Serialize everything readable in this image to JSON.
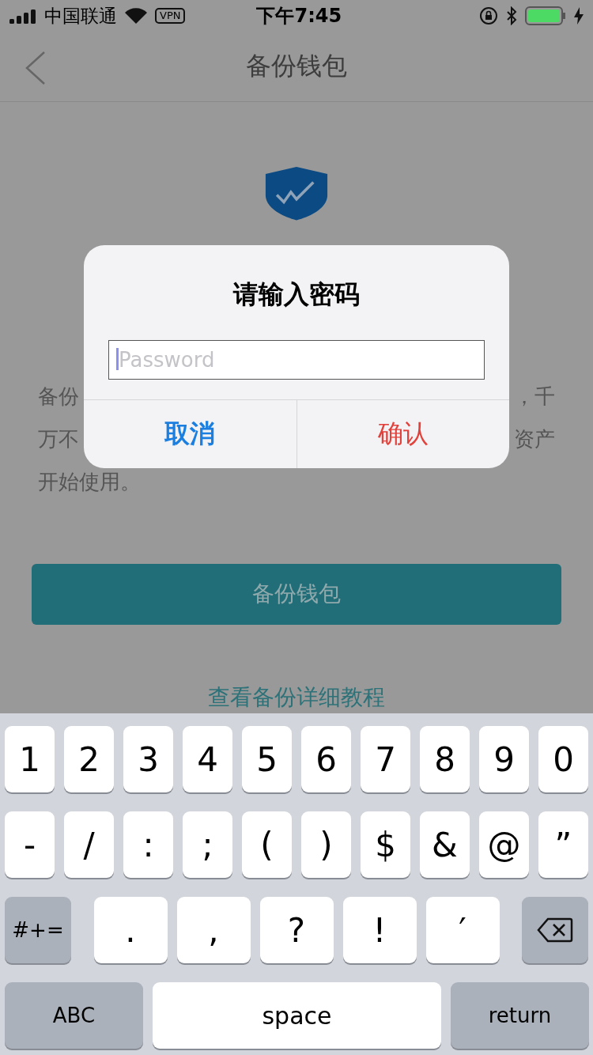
{
  "status_bar": {
    "carrier": "中国联通",
    "vpn": "VPN",
    "time": "下午7:45"
  },
  "nav": {
    "title": "备份钱包"
  },
  "page": {
    "paragraph_lines": [
      {
        "left": "备份",
        "right": "，千"
      },
      {
        "left": "万不",
        "right": "资产"
      },
      {
        "left": "开始使用。"
      }
    ],
    "button": "备份钱包",
    "link": "查看备份详细教程"
  },
  "dialog": {
    "title": "请输入密码",
    "password": {
      "placeholder": "Password"
    },
    "buttons": [
      {
        "label": "取消",
        "kind": "cancel"
      },
      {
        "label": "确认",
        "kind": "confirm"
      }
    ]
  },
  "keyboard": {
    "rows": [
      {
        "keys": [
          {
            "label": "1",
            "kind": "char"
          },
          {
            "label": "2",
            "kind": "char"
          },
          {
            "label": "3",
            "kind": "char"
          },
          {
            "label": "4",
            "kind": "char"
          },
          {
            "label": "5",
            "kind": "char"
          },
          {
            "label": "6",
            "kind": "char"
          },
          {
            "label": "7",
            "kind": "char"
          },
          {
            "label": "8",
            "kind": "char"
          },
          {
            "label": "9",
            "kind": "char"
          },
          {
            "label": "0",
            "kind": "char"
          }
        ]
      },
      {
        "keys": [
          {
            "label": "-",
            "kind": "char"
          },
          {
            "label": "/",
            "kind": "char"
          },
          {
            "label": ":",
            "kind": "char"
          },
          {
            "label": ";",
            "kind": "char"
          },
          {
            "label": "(",
            "kind": "char"
          },
          {
            "label": ")",
            "kind": "char"
          },
          {
            "label": "$",
            "kind": "char"
          },
          {
            "label": "&",
            "kind": "char"
          },
          {
            "label": "@",
            "kind": "char"
          },
          {
            "label": "”",
            "kind": "char"
          }
        ]
      },
      {
        "keys": [
          {
            "label": "#+=",
            "kind": "function"
          },
          {
            "label": ".",
            "kind": "wide"
          },
          {
            "label": ",",
            "kind": "wide"
          },
          {
            "label": "?",
            "kind": "wide"
          },
          {
            "label": "!",
            "kind": "wide"
          },
          {
            "label": "′",
            "kind": "wide"
          },
          {
            "kind": "backspace"
          }
        ]
      },
      {
        "keys": [
          {
            "label": "ABC",
            "kind": "function"
          },
          {
            "label": "space",
            "kind": "space"
          },
          {
            "label": "return",
            "kind": "function"
          }
        ]
      }
    ]
  }
}
